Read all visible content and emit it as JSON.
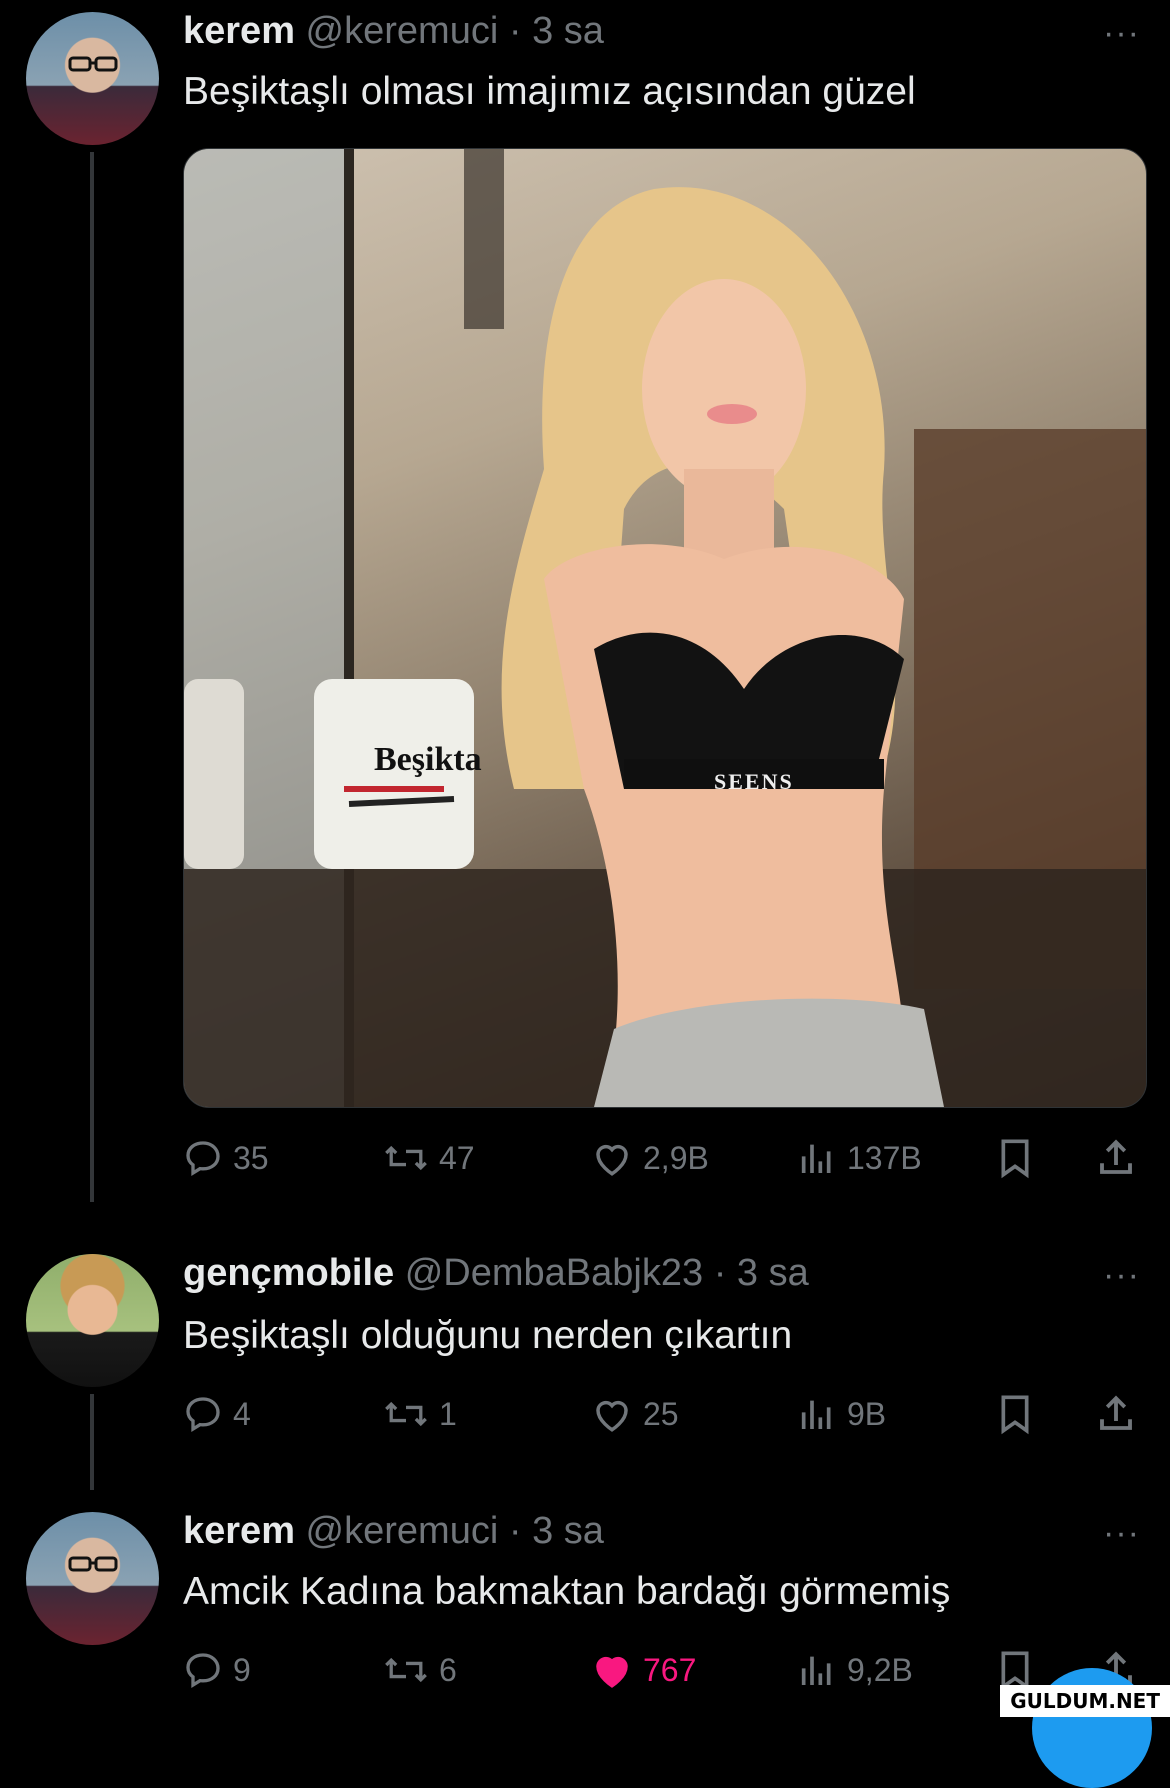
{
  "tweets": [
    {
      "name": "kerem",
      "handle": "@keremuci",
      "time": "3 sa",
      "text": "Beşiktaşlı olması imajımız açısından güzel",
      "replies": "35",
      "retweets": "47",
      "likes": "2,9B",
      "views": "137B",
      "liked": false
    },
    {
      "name": "gençmobile",
      "handle": "@DembaBabjk23",
      "time": "3 sa",
      "text": "Beşiktaşlı olduğunu nerden çıkartın",
      "replies": "4",
      "retweets": "1",
      "likes": "25",
      "views": "9B",
      "liked": false
    },
    {
      "name": "kerem",
      "handle": "@keremuci",
      "time": "3 sa",
      "text": "Amcik Kadına bakmaktan bardağı görmemiş",
      "replies": "9",
      "retweets": "6",
      "likes": "767",
      "views": "9,2B",
      "liked": true
    }
  ],
  "media": {
    "mug_text": "Beşikta",
    "top_text": "SEENS"
  },
  "separator": "·",
  "more": "···",
  "watermark": "GULDUM.NET",
  "colors": {
    "background": "#000000",
    "text": "#e7e9ea",
    "muted": "#71767b",
    "like_active": "#f91880",
    "accent": "#1d9bf0"
  }
}
